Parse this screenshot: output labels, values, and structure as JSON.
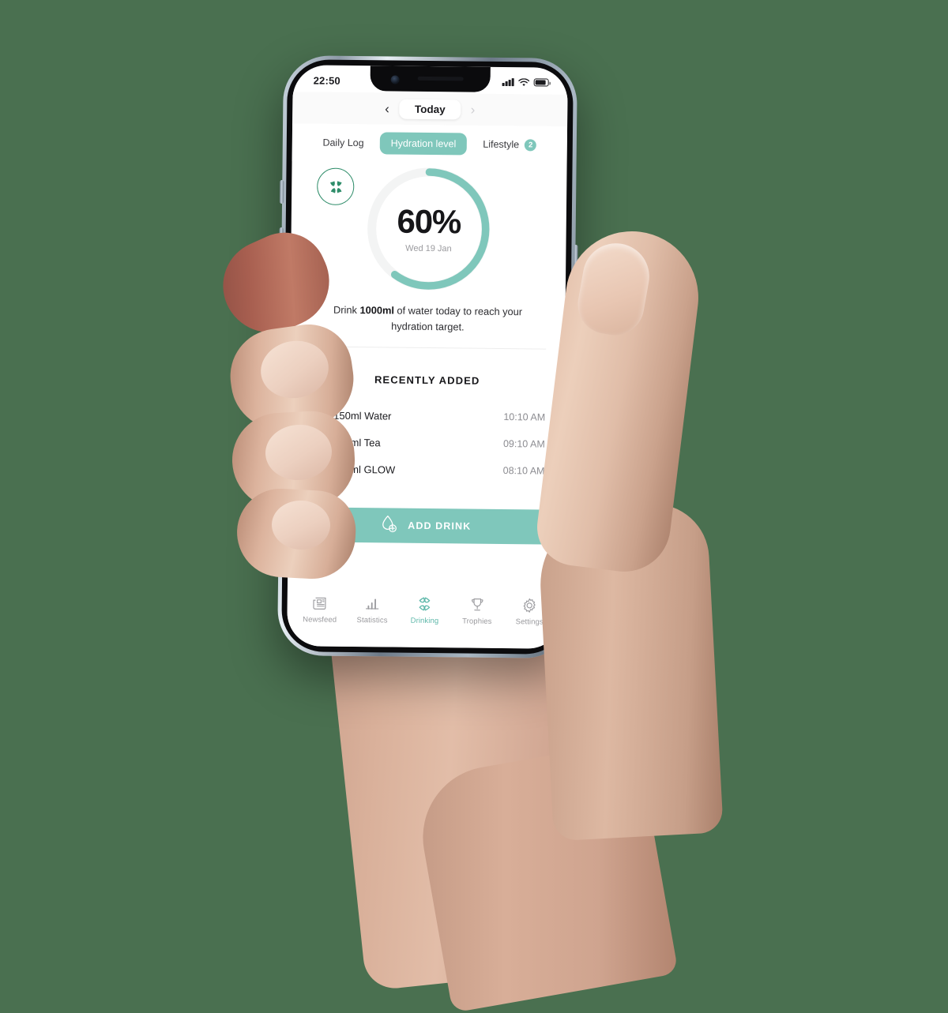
{
  "theme": {
    "background_green": "#4a7050",
    "accent_teal": "#7fc7bb",
    "accent_teal_dark": "#5fb8aa",
    "brand_green": "#2f8d6a",
    "glow_yellow": "#f1d16c",
    "text_dark": "#161619",
    "text_muted": "#8d8d92"
  },
  "status_bar": {
    "time": "22:50",
    "signal_icon": "signal-bars-icon",
    "wifi_icon": "wifi-icon",
    "battery_icon": "battery-icon"
  },
  "app_header": {
    "prev_icon": "chevron-left-icon",
    "next_icon": "chevron-right-icon",
    "title": "Today"
  },
  "tabs": [
    {
      "label": "Daily Log",
      "active": false,
      "badge": null
    },
    {
      "label": "Hydration level",
      "active": true,
      "badge": null
    },
    {
      "label": "Lifestyle",
      "active": false,
      "badge": "2"
    }
  ],
  "hydration": {
    "brand_icon": "clover-logo-icon",
    "percent": "60%",
    "percent_value": 60,
    "date": "Wed 19 Jan",
    "ring_track_color": "#f3f4f4",
    "ring_progress_color": "#7fc7bb"
  },
  "goal": {
    "prefix": "Drink ",
    "amount": "1000ml",
    "suffix": " of water today to reach your hydration target."
  },
  "recently_added": {
    "title": "RECENTLY ADDED",
    "items": [
      {
        "icon": "water-droplet-icon",
        "label": "150ml Water",
        "time": "10:10 AM"
      },
      {
        "icon": "tea-cup-icon",
        "label": "250ml Tea",
        "time": "09:10 AM"
      },
      {
        "icon": "glow-blob-icon",
        "label": "600ml GLOW",
        "time": "08:10 AM"
      }
    ]
  },
  "add_drink": {
    "icon": "droplet-plus-icon",
    "label": "ADD DRINK"
  },
  "bottom_nav": [
    {
      "icon": "newspaper-icon",
      "label": "Newsfeed",
      "active": false
    },
    {
      "icon": "bar-chart-icon",
      "label": "Statistics",
      "active": false
    },
    {
      "icon": "clover-icon",
      "label": "Drinking",
      "active": true
    },
    {
      "icon": "trophy-icon",
      "label": "Trophies",
      "active": false
    },
    {
      "icon": "gear-icon",
      "label": "Settings",
      "active": false
    }
  ]
}
